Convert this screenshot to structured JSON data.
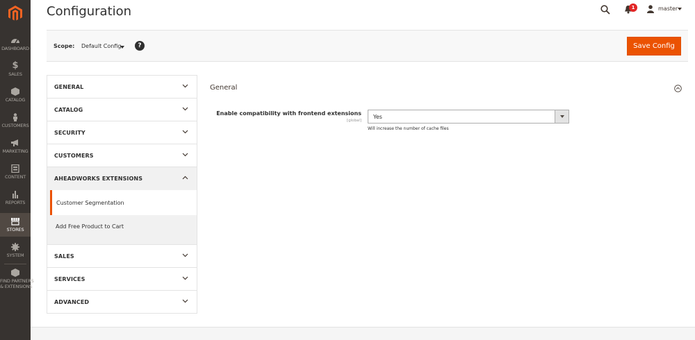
{
  "header": {
    "title": "Configuration",
    "notification_count": "1",
    "user_name": "master"
  },
  "sidebar": {
    "items": [
      {
        "label": "DASHBOARD",
        "icon": "dashboard-icon"
      },
      {
        "label": "SALES",
        "icon": "dollar-icon"
      },
      {
        "label": "CATALOG",
        "icon": "box-icon"
      },
      {
        "label": "CUSTOMERS",
        "icon": "person-icon"
      },
      {
        "label": "MARKETING",
        "icon": "megaphone-icon"
      },
      {
        "label": "CONTENT",
        "icon": "layout-icon"
      },
      {
        "label": "REPORTS",
        "icon": "bar-chart-icon"
      },
      {
        "label": "STORES",
        "icon": "store-icon",
        "active": true
      },
      {
        "label": "SYSTEM",
        "icon": "gear-icon"
      },
      {
        "label_line1": "FIND PARTNERS",
        "label_line2": "& EXTENSIONS",
        "icon": "partners-box-icon"
      }
    ]
  },
  "scope": {
    "label": "Scope:",
    "value": "Default Config",
    "help": "?"
  },
  "toolbar": {
    "save_label": "Save Config"
  },
  "tabs": [
    {
      "label": "GENERAL"
    },
    {
      "label": "CATALOG"
    },
    {
      "label": "SECURITY"
    },
    {
      "label": "CUSTOMERS"
    },
    {
      "label": "AHEADWORKS EXTENSIONS",
      "open": true,
      "children": [
        {
          "label": "Customer Segmentation",
          "active": true
        },
        {
          "label": "Add Free Product to Cart"
        }
      ]
    },
    {
      "label": "SALES"
    },
    {
      "label": "SERVICES"
    },
    {
      "label": "ADVANCED"
    }
  ],
  "main": {
    "section_title": "General",
    "field": {
      "label": "Enable compatibility with frontend extensions",
      "scope": "[global]",
      "value": "Yes",
      "note": "Will increase the number of cache files"
    }
  },
  "colors": {
    "accent": "#eb5202",
    "sidebar_bg": "#373330"
  }
}
